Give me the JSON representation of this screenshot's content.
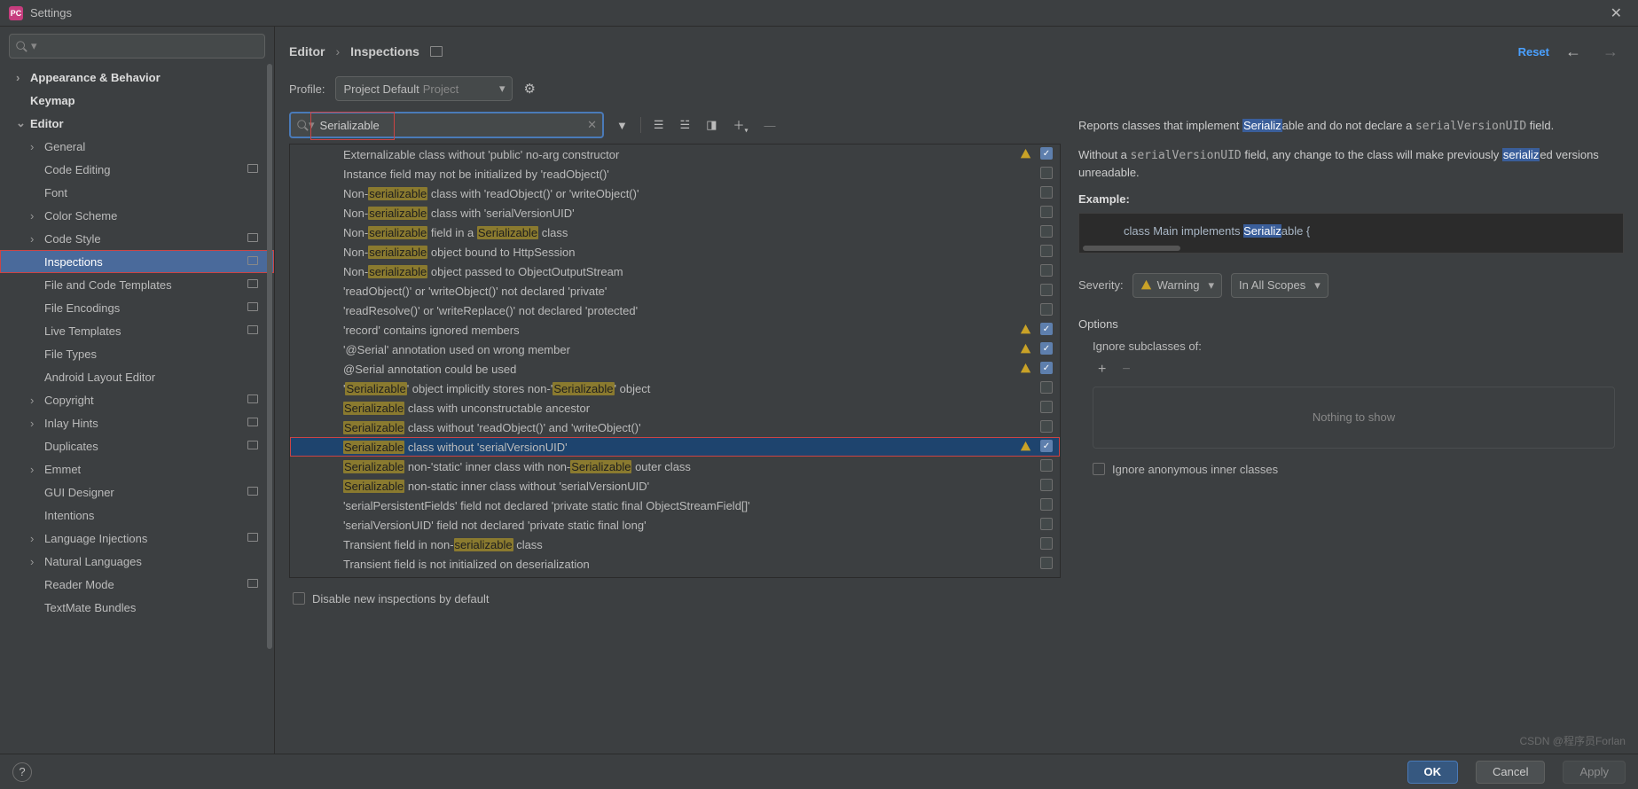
{
  "titlebar": {
    "title": "Settings"
  },
  "sidebar": {
    "search_placeholder": "",
    "items": [
      {
        "label": "Appearance & Behavior",
        "lvl": 0,
        "chev": ">",
        "bold": true
      },
      {
        "label": "Keymap",
        "lvl": 0,
        "bold": true
      },
      {
        "label": "Editor",
        "lvl": 0,
        "chev": "v",
        "bold": true
      },
      {
        "label": "General",
        "lvl": 1,
        "chev": ">"
      },
      {
        "label": "Code Editing",
        "lvl": 1,
        "cfg": true
      },
      {
        "label": "Font",
        "lvl": 1
      },
      {
        "label": "Color Scheme",
        "lvl": 1,
        "chev": ">"
      },
      {
        "label": "Code Style",
        "lvl": 1,
        "chev": ">",
        "cfg": true
      },
      {
        "label": "Inspections",
        "lvl": 1,
        "sel": true,
        "cfg": true,
        "redbox": true
      },
      {
        "label": "File and Code Templates",
        "lvl": 1,
        "cfg": true
      },
      {
        "label": "File Encodings",
        "lvl": 1,
        "cfg": true
      },
      {
        "label": "Live Templates",
        "lvl": 1,
        "cfg": true
      },
      {
        "label": "File Types",
        "lvl": 1
      },
      {
        "label": "Android Layout Editor",
        "lvl": 1
      },
      {
        "label": "Copyright",
        "lvl": 1,
        "chev": ">",
        "cfg": true
      },
      {
        "label": "Inlay Hints",
        "lvl": 1,
        "chev": ">",
        "cfg": true
      },
      {
        "label": "Duplicates",
        "lvl": 1,
        "cfg": true
      },
      {
        "label": "Emmet",
        "lvl": 1,
        "chev": ">"
      },
      {
        "label": "GUI Designer",
        "lvl": 1,
        "cfg": true
      },
      {
        "label": "Intentions",
        "lvl": 1
      },
      {
        "label": "Language Injections",
        "lvl": 1,
        "chev": ">",
        "cfg": true
      },
      {
        "label": "Natural Languages",
        "lvl": 1,
        "chev": ">"
      },
      {
        "label": "Reader Mode",
        "lvl": 1,
        "cfg": true
      },
      {
        "label": "TextMate Bundles",
        "lvl": 1
      }
    ]
  },
  "crumbs": {
    "a": "Editor",
    "sep": "›",
    "b": "Inspections",
    "reset": "Reset"
  },
  "profile": {
    "label": "Profile:",
    "name": "Project Default",
    "scope": "Project"
  },
  "ins_search": {
    "value": "Serializable"
  },
  "inspections": [
    {
      "pre": "Externalizable class without 'public' no-arg constructor",
      "warn": true,
      "on": true
    },
    {
      "pre": "Instance field may not be initialized by 'readObject()'"
    },
    {
      "pre": "Non-",
      "hl": "serializable",
      "post": " class with 'readObject()' or 'writeObject()'"
    },
    {
      "pre": "Non-",
      "hl": "serializable",
      "post": " class with 'serialVersionUID'"
    },
    {
      "pre": "Non-",
      "hl": "serializable",
      "post": " field in a ",
      "hl2": "Serializable",
      "post2": " class"
    },
    {
      "pre": "Non-",
      "hl": "serializable",
      "post": " object bound to HttpSession"
    },
    {
      "pre": "Non-",
      "hl": "serializable",
      "post": " object passed to ObjectOutputStream"
    },
    {
      "pre": "'readObject()' or 'writeObject()' not declared 'private'"
    },
    {
      "pre": "'readResolve()' or 'writeReplace()' not declared 'protected'"
    },
    {
      "pre": "'record' contains ignored members",
      "warn": true,
      "on": true
    },
    {
      "pre": "'@Serial' annotation used on wrong member",
      "warn": true,
      "on": true
    },
    {
      "pre": "@Serial annotation could be used",
      "warn": true,
      "on": true
    },
    {
      "pre": "'",
      "hl": "Serializable",
      "post": "' object implicitly stores non-'",
      "hl2": "Serializable",
      "post2": "' object"
    },
    {
      "hl": "Serializable",
      "post": " class with unconstructable ancestor"
    },
    {
      "hl": "Serializable",
      "post": " class without 'readObject()' and 'writeObject()'"
    },
    {
      "hl": "Serializable",
      "post": " class without 'serialVersionUID'",
      "warn": true,
      "on": true,
      "sel": true
    },
    {
      "hl": "Serializable",
      "post": " non-'static' inner class with non-",
      "hl2": "Serializable",
      "post2": " outer class"
    },
    {
      "hl": "Serializable",
      "post": " non-static inner class without 'serialVersionUID'"
    },
    {
      "pre": "'serialPersistentFields' field not declared 'private static final ObjectStreamField[]'"
    },
    {
      "pre": "'serialVersionUID' field not declared 'private static final long'"
    },
    {
      "pre": "Transient field in non-",
      "hl": "serializable",
      "post": " class"
    },
    {
      "pre": "Transient field is not initialized on deserialization"
    }
  ],
  "disable_new": "Disable new inspections by default",
  "desc": {
    "p1a": "Reports classes that implement ",
    "p1hl": "Serializ",
    "p1b": "able",
    "p1c": " and do not declare a ",
    "p1code": "serialVersionUID",
    "p1d": " field.",
    "p2a": "Without a ",
    "p2code": "serialVersionUID",
    "p2b": " field, any change to the class will make previously ",
    "p2hl": "serializ",
    "p2c": "ed versions unreadable.",
    "ex": "Example:",
    "code_a": "class Main implements ",
    "code_hl": "Serializ",
    "code_b": "able {"
  },
  "severity": {
    "label": "Severity:",
    "value": "Warning",
    "scope": "In All Scopes"
  },
  "options": {
    "hdr": "Options",
    "sub": "Ignore subclasses of:",
    "empty": "Nothing to show",
    "ign": "Ignore anonymous inner classes"
  },
  "footer": {
    "ok": "OK",
    "cancel": "Cancel",
    "apply": "Apply"
  },
  "watermark": "CSDN @程序员Forlan"
}
